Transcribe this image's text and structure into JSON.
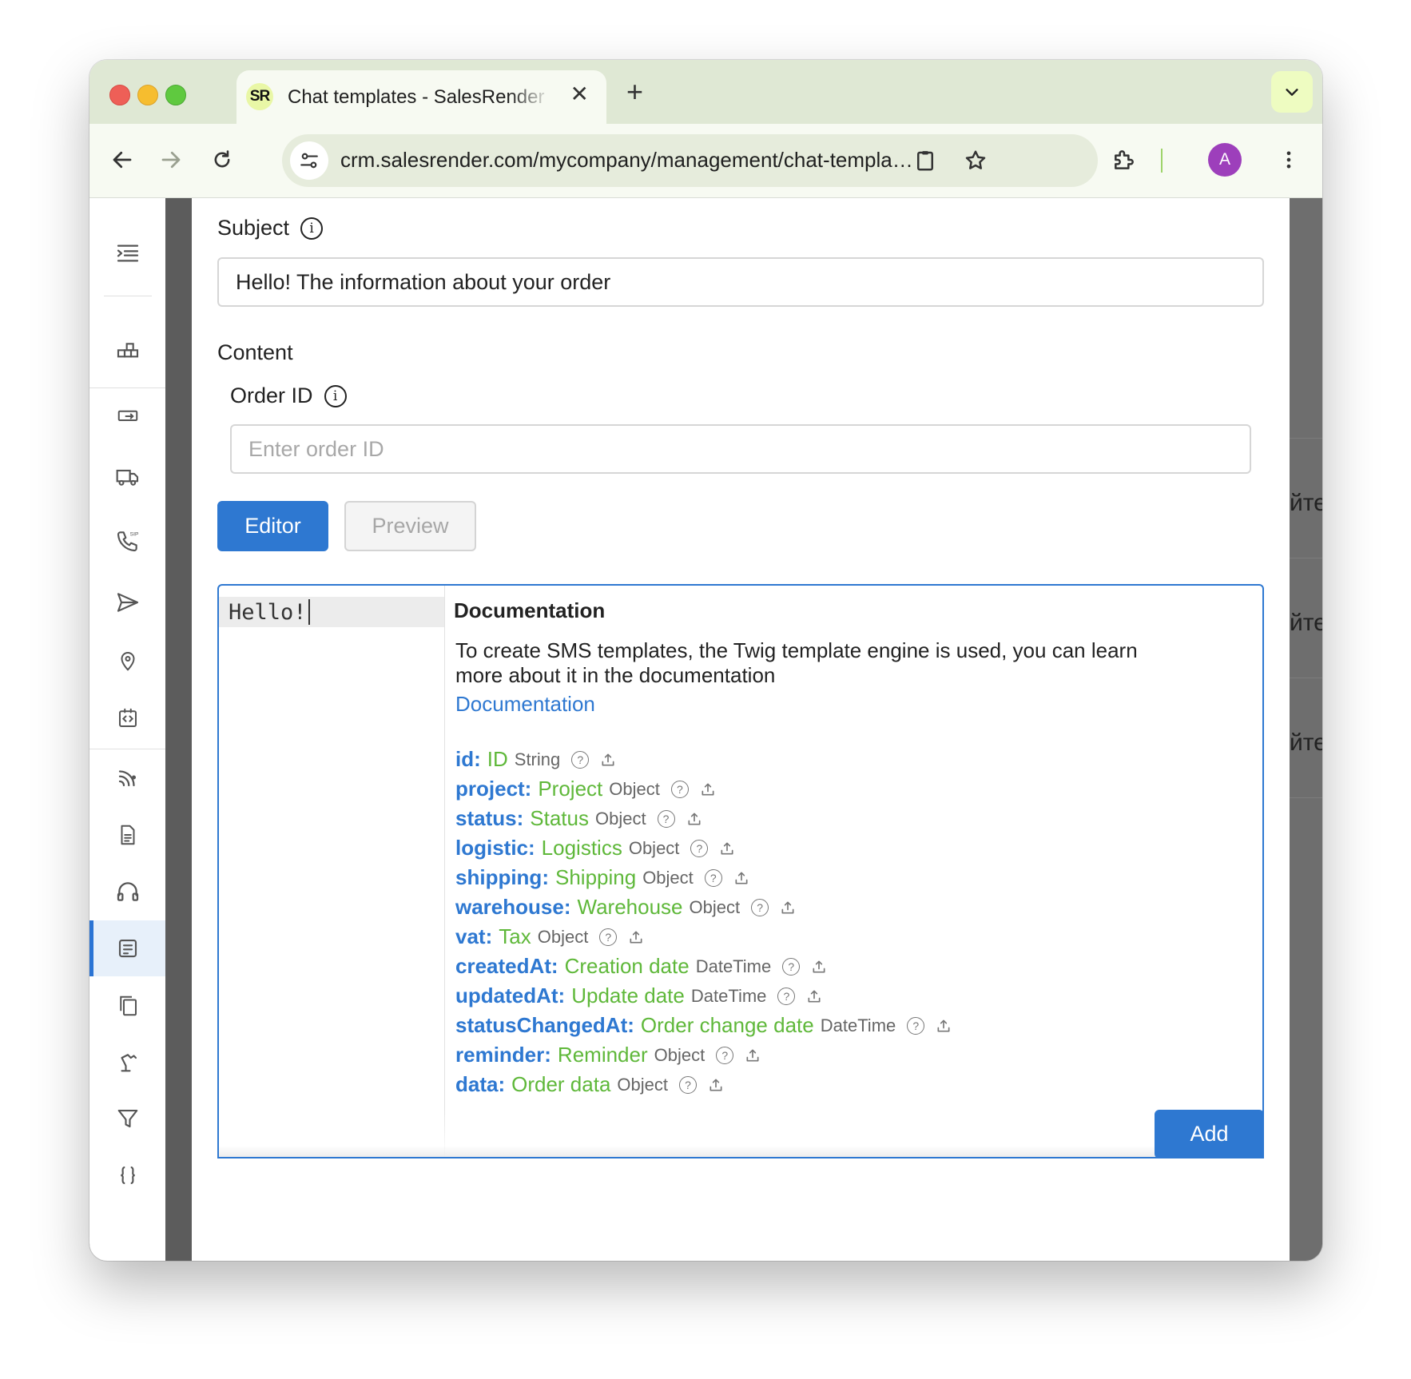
{
  "browser": {
    "tab_title": "Chat templates - SalesRender",
    "favicon_text": "SR",
    "close_symbol": "✕",
    "new_tab_symbol": "+",
    "url": "crm.salesrender.com/mycompany/management/chat-templates",
    "avatar_letter": "A"
  },
  "sidebar": {
    "items": [
      "menu-icon",
      "modules-icon",
      "transfer-icon",
      "delivery-truck-icon",
      "sip-phone-icon",
      "send-icon",
      "location-pin-icon",
      "code-icon",
      "signal-icon",
      "document-icon",
      "headset-icon",
      "chat-templates-icon",
      "copy-icon",
      "robot-arm-icon",
      "funnel-icon",
      "braces-icon"
    ],
    "active": "chat-templates-icon"
  },
  "backdrop": {
    "fragments": [
      "йте",
      "йте",
      "йте"
    ]
  },
  "form": {
    "subject_label": "Subject",
    "subject_value": "Hello! The information about your order",
    "content_label": "Content",
    "order_id_label": "Order ID",
    "order_id_placeholder": "Enter order ID",
    "editor_tab": "Editor",
    "preview_tab": "Preview",
    "add_button": "Add"
  },
  "editor": {
    "code": "Hello!",
    "doc_title": "Documentation",
    "doc_text": "To create SMS templates, the Twig template engine is used, you can learn more about it in the documentation",
    "doc_link": "Documentation",
    "fields": [
      {
        "key": "id:",
        "name": "ID",
        "type": "String"
      },
      {
        "key": "project:",
        "name": "Project",
        "type": "Object"
      },
      {
        "key": "status:",
        "name": "Status",
        "type": "Object"
      },
      {
        "key": "logistic:",
        "name": "Logistics",
        "type": "Object"
      },
      {
        "key": "shipping:",
        "name": "Shipping",
        "type": "Object"
      },
      {
        "key": "warehouse:",
        "name": "Warehouse",
        "type": "Object"
      },
      {
        "key": "vat:",
        "name": "Tax",
        "type": "Object"
      },
      {
        "key": "createdAt:",
        "name": "Creation date",
        "type": "DateTime"
      },
      {
        "key": "updatedAt:",
        "name": "Update date",
        "type": "DateTime"
      },
      {
        "key": "statusChangedAt:",
        "name": "Order change date",
        "type": "DateTime"
      },
      {
        "key": "reminder:",
        "name": "Reminder",
        "type": "Object"
      },
      {
        "key": "data:",
        "name": "Order data",
        "type": "Object"
      }
    ]
  },
  "colors": {
    "accent": "#2e78d1",
    "field_name": "#5fb83a",
    "tabstrip": "#dfe8d4"
  }
}
